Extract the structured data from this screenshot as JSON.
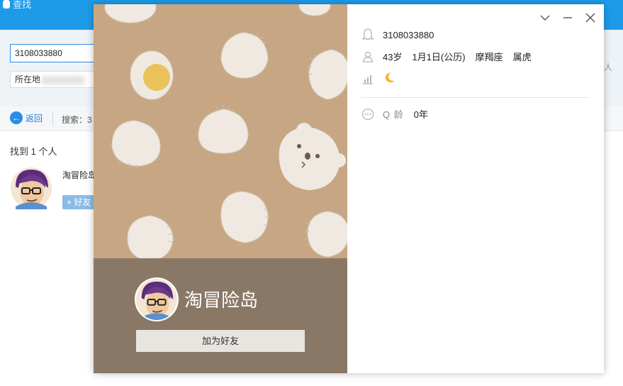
{
  "background": {
    "title": "查找",
    "search": {
      "value": "3108033880"
    },
    "location_label": "所在地",
    "right_edge_char": "人",
    "toolbar": {
      "back_label": "返回",
      "search_label": "搜索：3"
    },
    "result_count": "找到 1 个人",
    "result": {
      "name": "淘冒险岛",
      "add_label": "+ 好友"
    }
  },
  "profile_card": {
    "qq_number": "3108033880",
    "age": "43岁",
    "birthday": "1月1日(公历)",
    "zodiac": "摩羯座",
    "chinese_zodiac": "属虎",
    "level_icon": "moon",
    "q_age_label": "Q 龄",
    "q_age_value": "0年",
    "nickname": "淘冒险岛",
    "add_friend_label": "加为好友",
    "colors": {
      "cover": "#c7a783",
      "bottom": "#8a7867",
      "accent": "#1e9be8"
    }
  }
}
